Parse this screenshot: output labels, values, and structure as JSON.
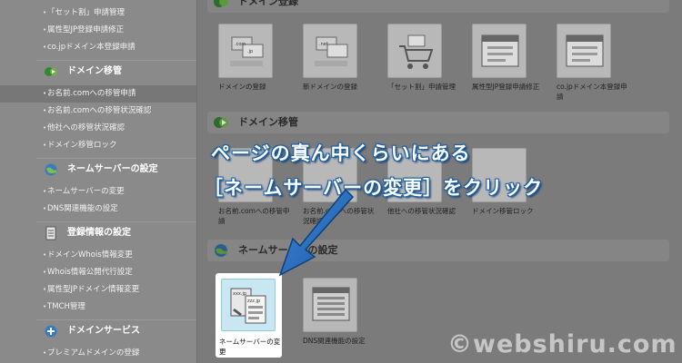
{
  "sidebar": {
    "top_items": [
      "「セット割」申請管理",
      "属性型JP登録申請修正",
      "co.jpドメイン本登録申請"
    ],
    "sections": [
      {
        "title": "ドメイン移管",
        "items": [
          "お名前.comへの移管申請",
          "お名前.comへの移管状況確認",
          "他社への移管状況確認",
          "ドメイン移管ロック"
        ]
      },
      {
        "title": "ネームサーバーの設定",
        "items": [
          "ネームサーバーの変更",
          "DNS関連機能の設定"
        ]
      },
      {
        "title": "登録情報の設定",
        "items": [
          "ドメインWhois情報変更",
          "Whois情報公開代行設定",
          "属性型JPドメイン情報変更",
          "TMCH管理"
        ]
      },
      {
        "title": "ドメインサービス",
        "items": [
          "プレミアムドメインの登録"
        ]
      }
    ]
  },
  "main": {
    "sections": [
      {
        "title": "ドメイン登録",
        "tiles": [
          "ドメインの登録",
          "新ドメインの登録",
          "「セット割」申請管理",
          "属性型JP登録申請修正",
          "co.jpドメイン本登録申請"
        ]
      },
      {
        "title": "ドメイン移管",
        "tiles": [
          "お名前.comへの移管申請",
          "お名前.comへの移管状況確認",
          "他社への移管状況確認",
          "ドメイン移管ロック"
        ]
      },
      {
        "title": "ネームサーバーの設定",
        "tiles": [
          "ネームサーバーの変更",
          "DNS関連機能の設定"
        ]
      }
    ],
    "icon_text": {
      "com": ".com",
      "jp": ".jp",
      "net": ".net",
      "xxx": "xxx.jp",
      "zzz": "zzz.jp"
    }
  },
  "annotation": {
    "line1": "ページの真ん中くらいにある",
    "line2": "［ネームサーバーの変更］をクリック"
  },
  "watermark": "©webshiru.com",
  "colors": {
    "accent_blue": "#1d5fa5",
    "highlight_tile": "#c9e6f3",
    "overlay_gray": "#7d7d7d"
  }
}
